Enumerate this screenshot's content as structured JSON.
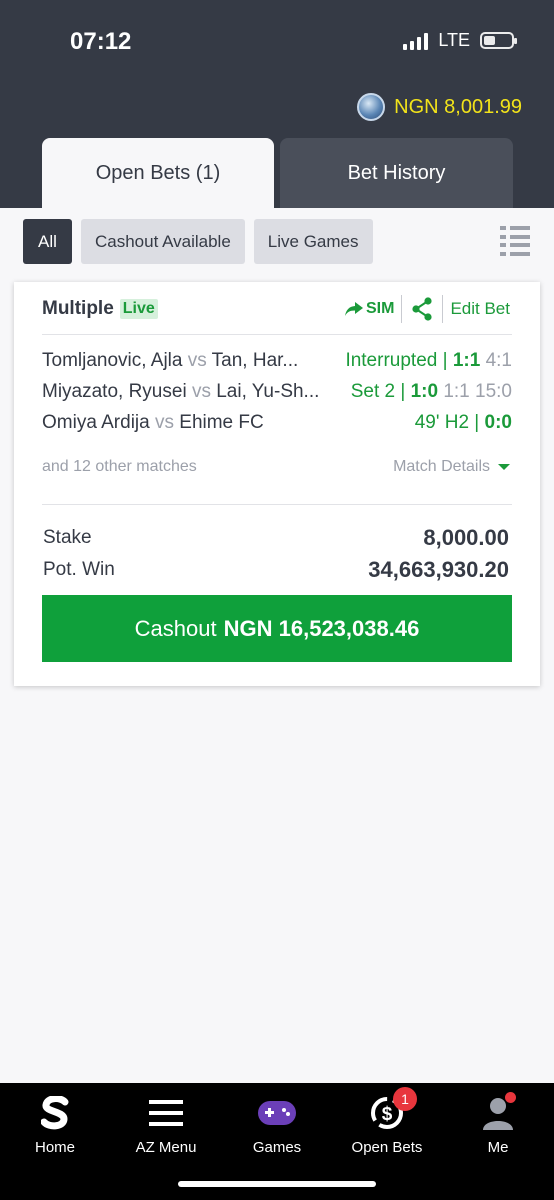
{
  "status_bar": {
    "time": "07:12",
    "network": "LTE"
  },
  "account": {
    "balance": "NGN 8,001.99"
  },
  "tabs": [
    {
      "label": "Open Bets (1)",
      "active": true
    },
    {
      "label": "Bet History",
      "active": false
    }
  ],
  "filters": [
    {
      "label": "All",
      "active": true
    },
    {
      "label": "Cashout Available",
      "active": false
    },
    {
      "label": "Live Games",
      "active": false
    }
  ],
  "bet": {
    "type": "Multiple",
    "live_label": "Live",
    "actions": {
      "sim": "SIM",
      "edit": "Edit Bet"
    },
    "matches": [
      {
        "home": "Tomljanovic, Ajla",
        "vs": "vs",
        "away": "Tan, Har...",
        "status": "Interrupted | ",
        "score": "1:1",
        "extra": "4:1"
      },
      {
        "home": "Miyazato, Ryusei",
        "vs": "vs",
        "away": "Lai, Yu-Sh...",
        "status": "Set 2 | ",
        "score": "1:0",
        "extra": "1:1 15:0"
      },
      {
        "home": "Omiya Ardija",
        "vs": "vs",
        "away": "Ehime FC",
        "status": "49' H2 | ",
        "score": "0:0",
        "extra": ""
      }
    ],
    "other_matches": "and 12 other matches",
    "match_details": "Match Details",
    "stake_label": "Stake",
    "stake": "8,000.00",
    "pot_win_label": "Pot. Win",
    "pot_win": "34,663,930.20",
    "cashout_label": "Cashout",
    "cashout_amount": "NGN 16,523,038.46"
  },
  "bottom_nav": [
    {
      "label": "Home",
      "icon": "sportybet-logo-icon"
    },
    {
      "label": "AZ Menu",
      "icon": "hamburger-menu-icon"
    },
    {
      "label": "Games",
      "icon": "gamepad-icon"
    },
    {
      "label": "Open Bets",
      "icon": "cashout-dollar-icon",
      "badge": "1",
      "active": true
    },
    {
      "label": "Me",
      "icon": "user-icon"
    }
  ],
  "colors": {
    "header": "#353a45",
    "green": "#1b9a3a",
    "cashout_button": "#0fa03b",
    "balance": "#f2e31a",
    "badge": "#e8363d"
  }
}
